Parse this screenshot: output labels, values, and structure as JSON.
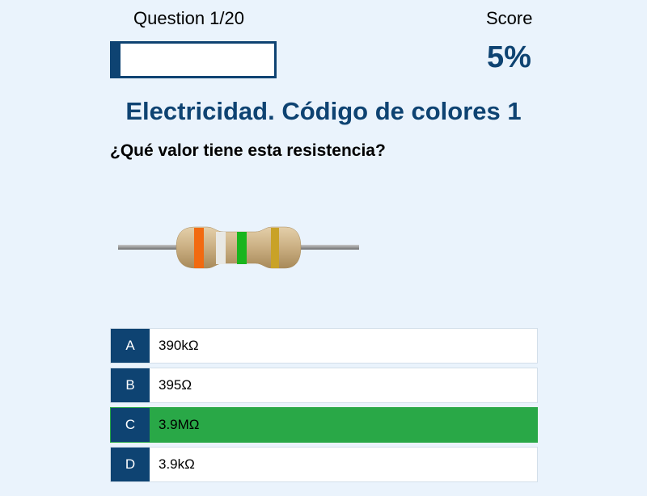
{
  "header": {
    "question_counter": "Question 1/20",
    "progress_fraction": 0.05,
    "score_label": "Score",
    "score_value": "5%"
  },
  "quiz": {
    "title": "Electricidad. Código de colores 1",
    "question": "¿Qué valor tiene esta resistencia?"
  },
  "resistor": {
    "bands": [
      "orange",
      "white",
      "brown",
      "green",
      "gold"
    ],
    "band_colors": [
      "#f26a10",
      "#e8e8e4",
      "#8a6a3a",
      "#19b51e",
      "#c9a227"
    ]
  },
  "options": [
    {
      "letter": "A",
      "text": "390kΩ",
      "selected": false
    },
    {
      "letter": "B",
      "text": "395Ω",
      "selected": false
    },
    {
      "letter": "C",
      "text": "3.9MΩ",
      "selected": true
    },
    {
      "letter": "D",
      "text": "3.9kΩ",
      "selected": false
    }
  ],
  "colors": {
    "primary": "#0e4372",
    "selected": "#29a847",
    "background": "#eaf3fc"
  }
}
